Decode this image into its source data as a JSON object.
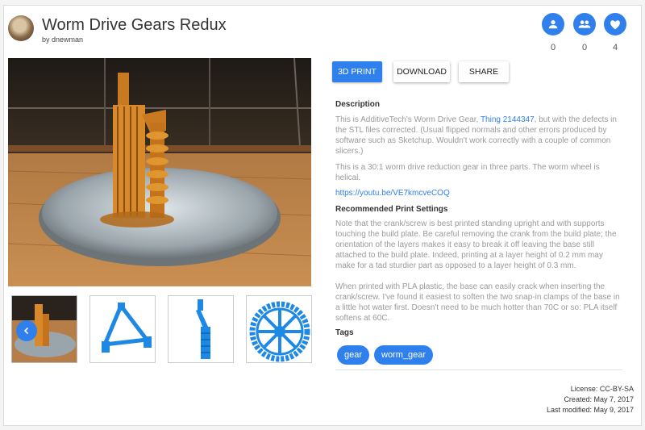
{
  "header": {
    "title": "Worm Drive Gears Redux",
    "byline": "by dnewman"
  },
  "social": [
    {
      "icon": "person-icon",
      "count": "0"
    },
    {
      "icon": "group-icon",
      "count": "0"
    },
    {
      "icon": "heart-icon",
      "count": "4"
    }
  ],
  "actions": {
    "print_label": "3D PRINT",
    "download_label": "DOWNLOAD",
    "share_label": "SHARE"
  },
  "description": {
    "heading": "Description",
    "p1_before": "This is AdditiveTech's Worm Drive Gear, ",
    "p1_link": "Thing 2144347",
    "p1_after": ", but with the defects in the STL files corrected. (Usual flipped normals and other errors produced by software such as Sketchup. Wouldn't work correctly with a couple of common slicers.)",
    "p2": "This is a 30:1 worm drive reduction gear in three parts. The worm wheel is helical.",
    "video_link": "https://youtu.be/VE7kmcveCOQ"
  },
  "print_settings": {
    "heading": "Recommended Print Settings",
    "p1": "Note that the crank/screw is best printed standing upright and with supports touching the build plate. Be careful removing the crank from the build plate; the orientation of the layers makes it easy to break it off leaving the base still attached to the build plate. Indeed, printing at a layer height of 0.2 mm may make for a tad sturdier part as opposed to a layer height of 0.3 mm.",
    "p2": "When printed with PLA plastic, the base can easily crack when inserting the crank/screw. I've found it easiest to soften the two snap-in clamps of the base in a little hot water first. Doesn't need to be much hotter than 70C or so: PLA itself softens at 60C."
  },
  "tags": {
    "heading": "Tags",
    "items": [
      "gear",
      "worm_gear"
    ]
  },
  "meta": {
    "license": "License: CC-BY-SA",
    "created": "Created: May 7, 2017",
    "modified": "Last modified: May 9, 2017"
  },
  "colors": {
    "accent": "#2f80ed",
    "print_orange": "#d4821f",
    "model_blue": "#1e88e5"
  }
}
